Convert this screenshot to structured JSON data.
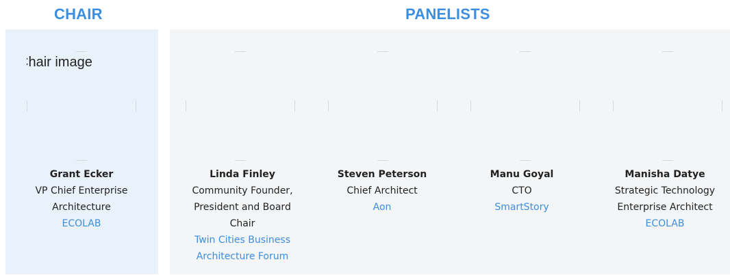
{
  "chair": {
    "heading": "CHAIR",
    "image_alt": "Chair image",
    "person": {
      "name": "Grant Ecker",
      "title": "VP Chief Enterprise Architecture",
      "org": "ECOLAB"
    }
  },
  "panel": {
    "heading": "PANELISTS",
    "people": [
      {
        "name": "Linda Finley",
        "title": "Community Founder, President and Board Chair",
        "org": "Twin Cities Business Architecture Forum"
      },
      {
        "name": "Steven Peterson",
        "title": "Chief Architect",
        "org": "Aon"
      },
      {
        "name": "Manu Goyal",
        "title": "CTO",
        "org": "SmartStory"
      },
      {
        "name": "Manisha Datye",
        "title": "Strategic Technology Enterprise Architect",
        "org": "ECOLAB"
      }
    ]
  },
  "colors": {
    "accent": "#3b8ee0",
    "chair_bg": "#e9f2fb",
    "panel_bg": "#f3f5f7"
  }
}
